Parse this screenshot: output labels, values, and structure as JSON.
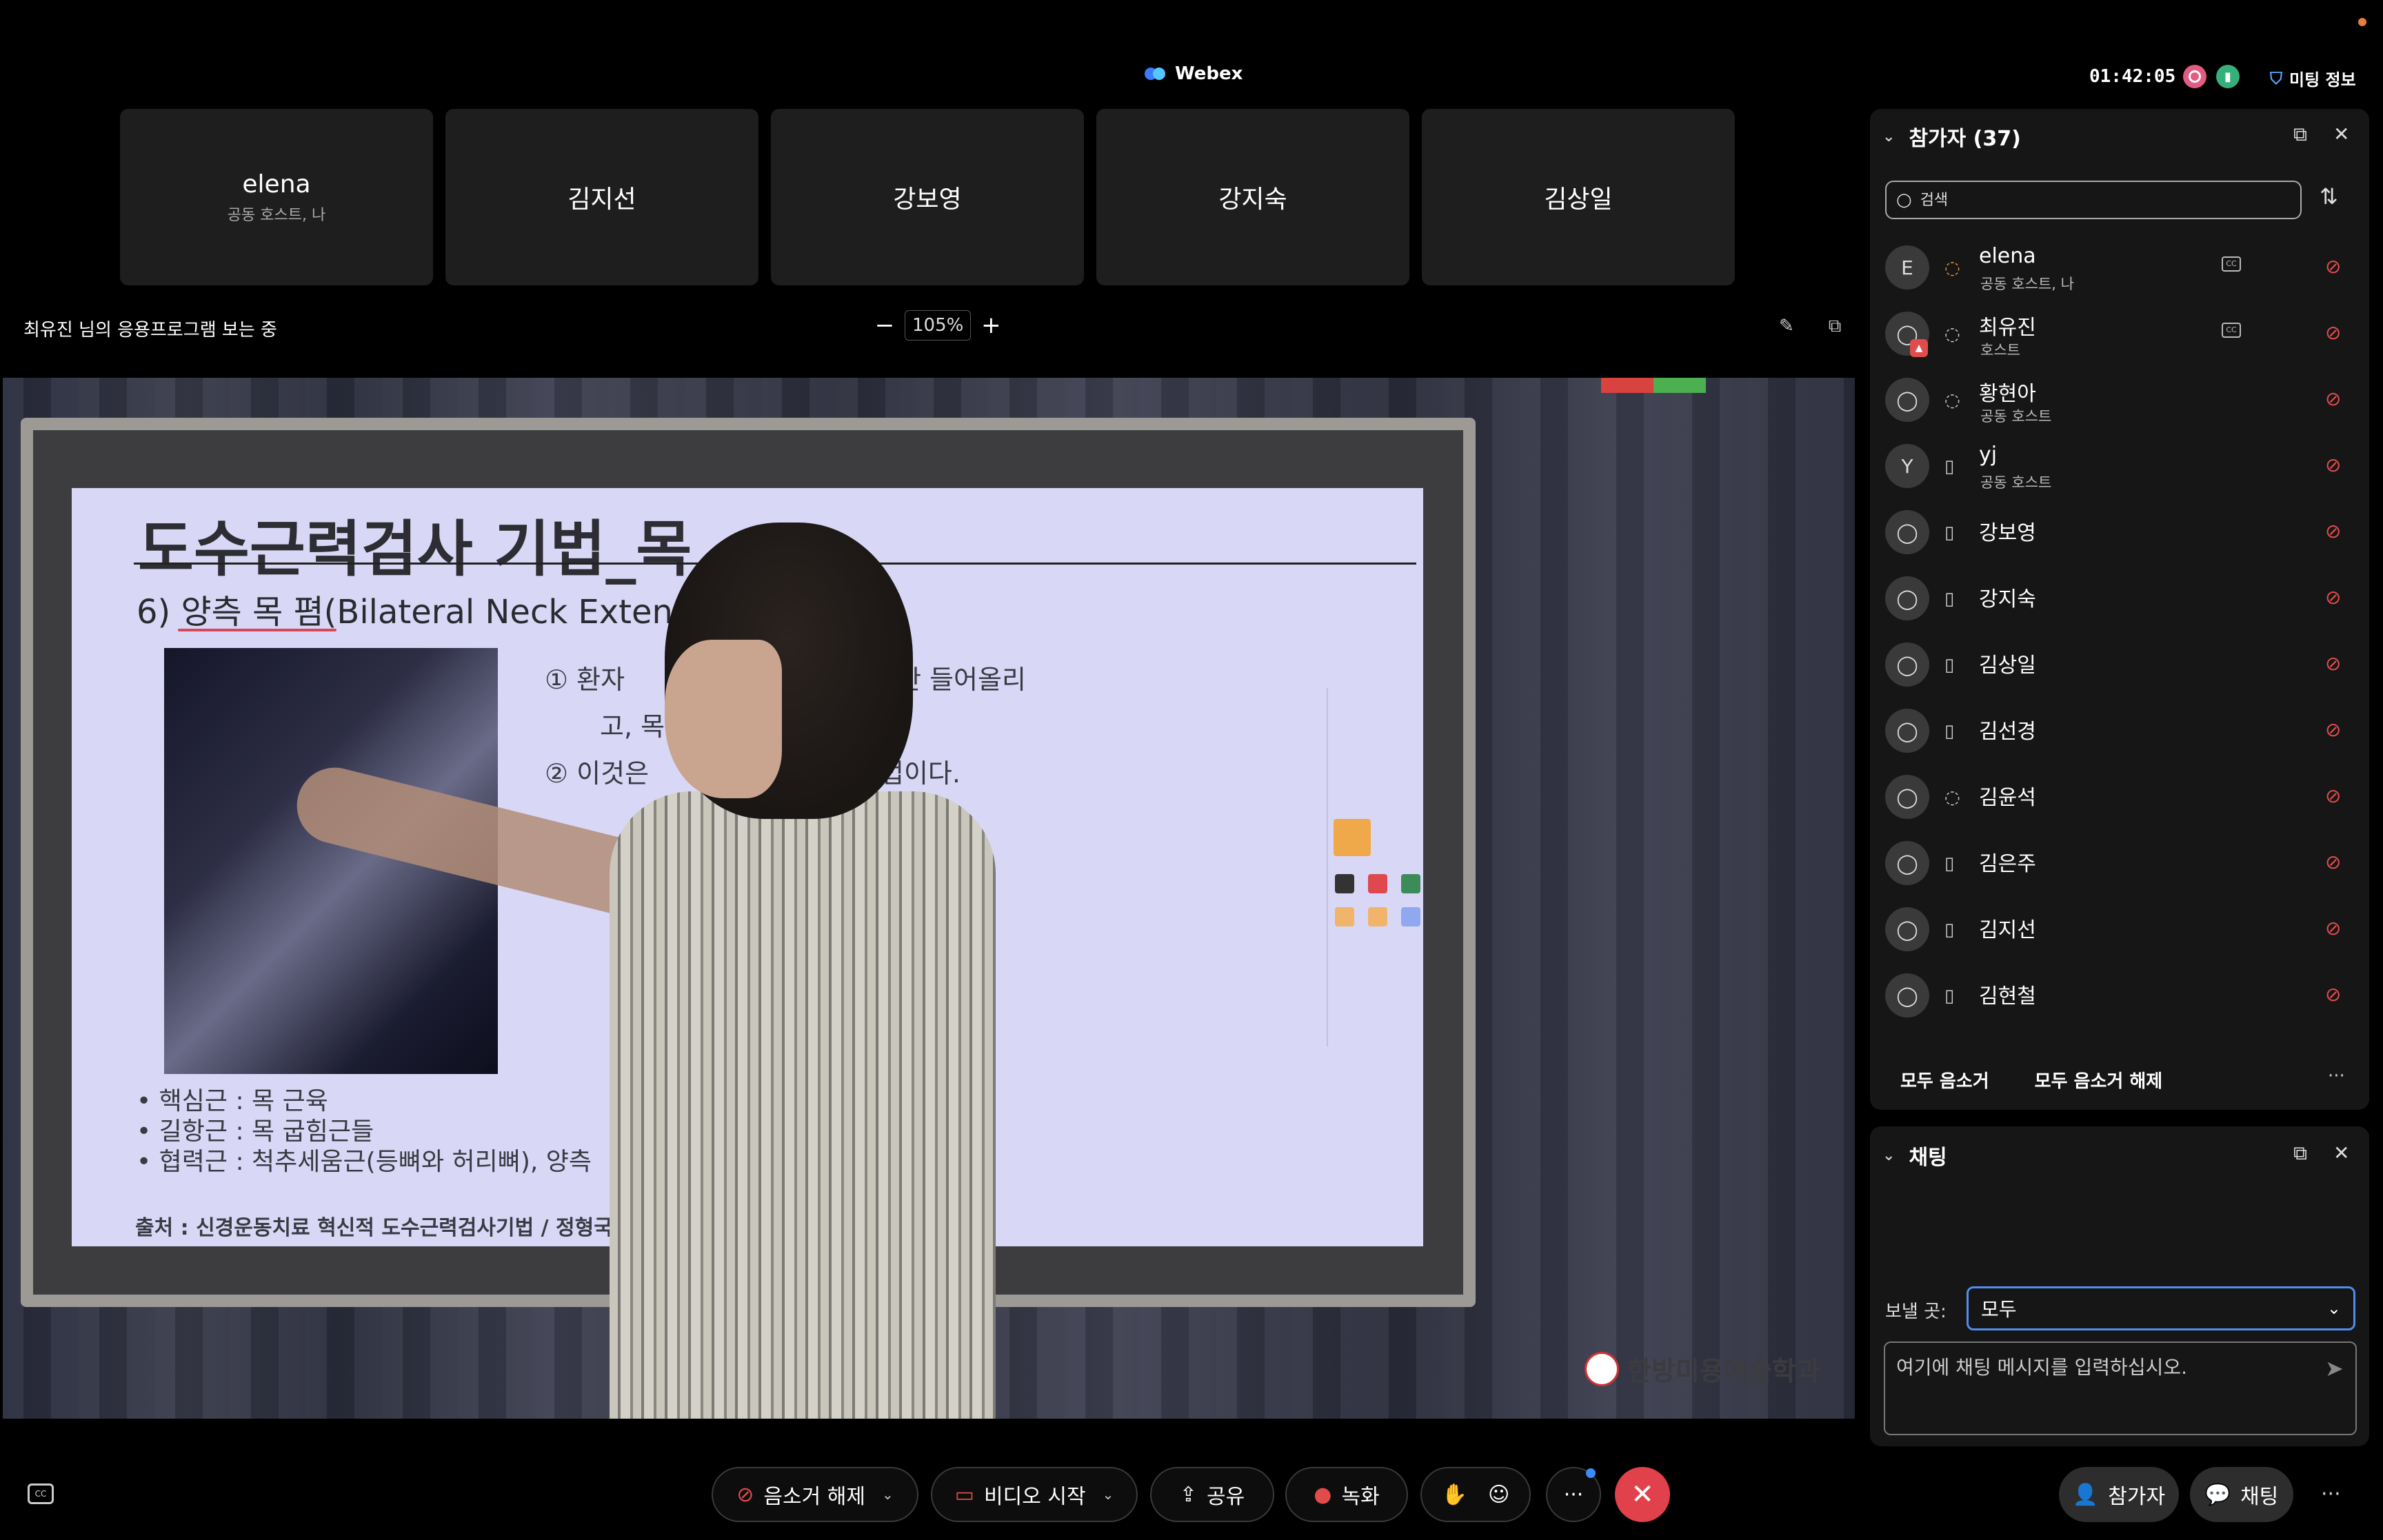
{
  "app": {
    "title": "Webex",
    "clock": "01:42:05",
    "meeting_info": "미팅 정보"
  },
  "tiles": [
    {
      "name": "elena",
      "sub": "공동 호스트, 나"
    },
    {
      "name": "김지선",
      "sub": ""
    },
    {
      "name": "강보영",
      "sub": ""
    },
    {
      "name": "강지숙",
      "sub": ""
    },
    {
      "name": "김상일",
      "sub": ""
    }
  ],
  "share": {
    "viewing_text": "최유진 님의 응용프로그램 보는 중",
    "zoom": "105%",
    "zoom_minus": "−",
    "zoom_plus": "+"
  },
  "slide": {
    "title": "도수근력검사 기법_목",
    "subtitle": "6) 양측 목 폄(Bilateral Neck Extens",
    "text_1a": "①   환자",
    "text_1b": "약간 들어올리",
    "text_2": "고, 목",
    "text_3a": "②   이것은",
    "text_3b": "방법이다.",
    "bullet_1": "•  핵심근 : 목 근육",
    "bullet_2": "•  길항근 : 목 굽힘근들",
    "bullet_3": "•  협력근 : 척추세움근(등뼈와 허리뼈), 양측",
    "source": "출처 : 신경운동치료 혁신적 도수근력검사기법 / 정형국",
    "watermark": "한방미용예술학과"
  },
  "participants_panel": {
    "title": "참가자 (37)",
    "search_placeholder": "검색",
    "items": [
      {
        "initial": "E",
        "name": "elena",
        "role": "공동 호스트, 나",
        "device": "headset",
        "cc": true
      },
      {
        "initial": "",
        "name": "최유진",
        "role": "호스트",
        "device": "headset",
        "cc": true,
        "sharing": true
      },
      {
        "initial": "",
        "name": "황현아",
        "role": "공동 호스트",
        "device": "headset",
        "cc": false
      },
      {
        "initial": "Y",
        "name": "yj",
        "role": "공동 호스트",
        "device": "phone",
        "cc": false
      },
      {
        "initial": "",
        "name": "강보영",
        "role": "",
        "device": "phone",
        "cc": false
      },
      {
        "initial": "",
        "name": "강지숙",
        "role": "",
        "device": "phone",
        "cc": false
      },
      {
        "initial": "",
        "name": "김상일",
        "role": "",
        "device": "phone",
        "cc": false
      },
      {
        "initial": "",
        "name": "김선경",
        "role": "",
        "device": "phone",
        "cc": false
      },
      {
        "initial": "",
        "name": "김윤석",
        "role": "",
        "device": "headset",
        "cc": false
      },
      {
        "initial": "",
        "name": "김은주",
        "role": "",
        "device": "phone",
        "cc": false
      },
      {
        "initial": "",
        "name": "김지선",
        "role": "",
        "device": "phone",
        "cc": false
      },
      {
        "initial": "",
        "name": "김현철",
        "role": "",
        "device": "phone",
        "cc": false
      }
    ],
    "mute_all": "모두 음소거",
    "unmute_all": "모두 음소거 해제"
  },
  "chat_panel": {
    "title": "채팅",
    "send_to_label": "보낼 곳:",
    "send_to_value": "모두",
    "input_placeholder": "여기에 채팅 메시지를 입력하십시오."
  },
  "controls": {
    "unmute": "음소거 해제",
    "start_video": "비디오 시작",
    "share": "공유",
    "record": "녹화",
    "participants": "참가자",
    "chat": "채팅"
  },
  "colors": {
    "accent_blue": "#4f8df0",
    "mute_red": "#e04b4b",
    "end_call": "#e0414a",
    "panel_bg": "#161616"
  }
}
